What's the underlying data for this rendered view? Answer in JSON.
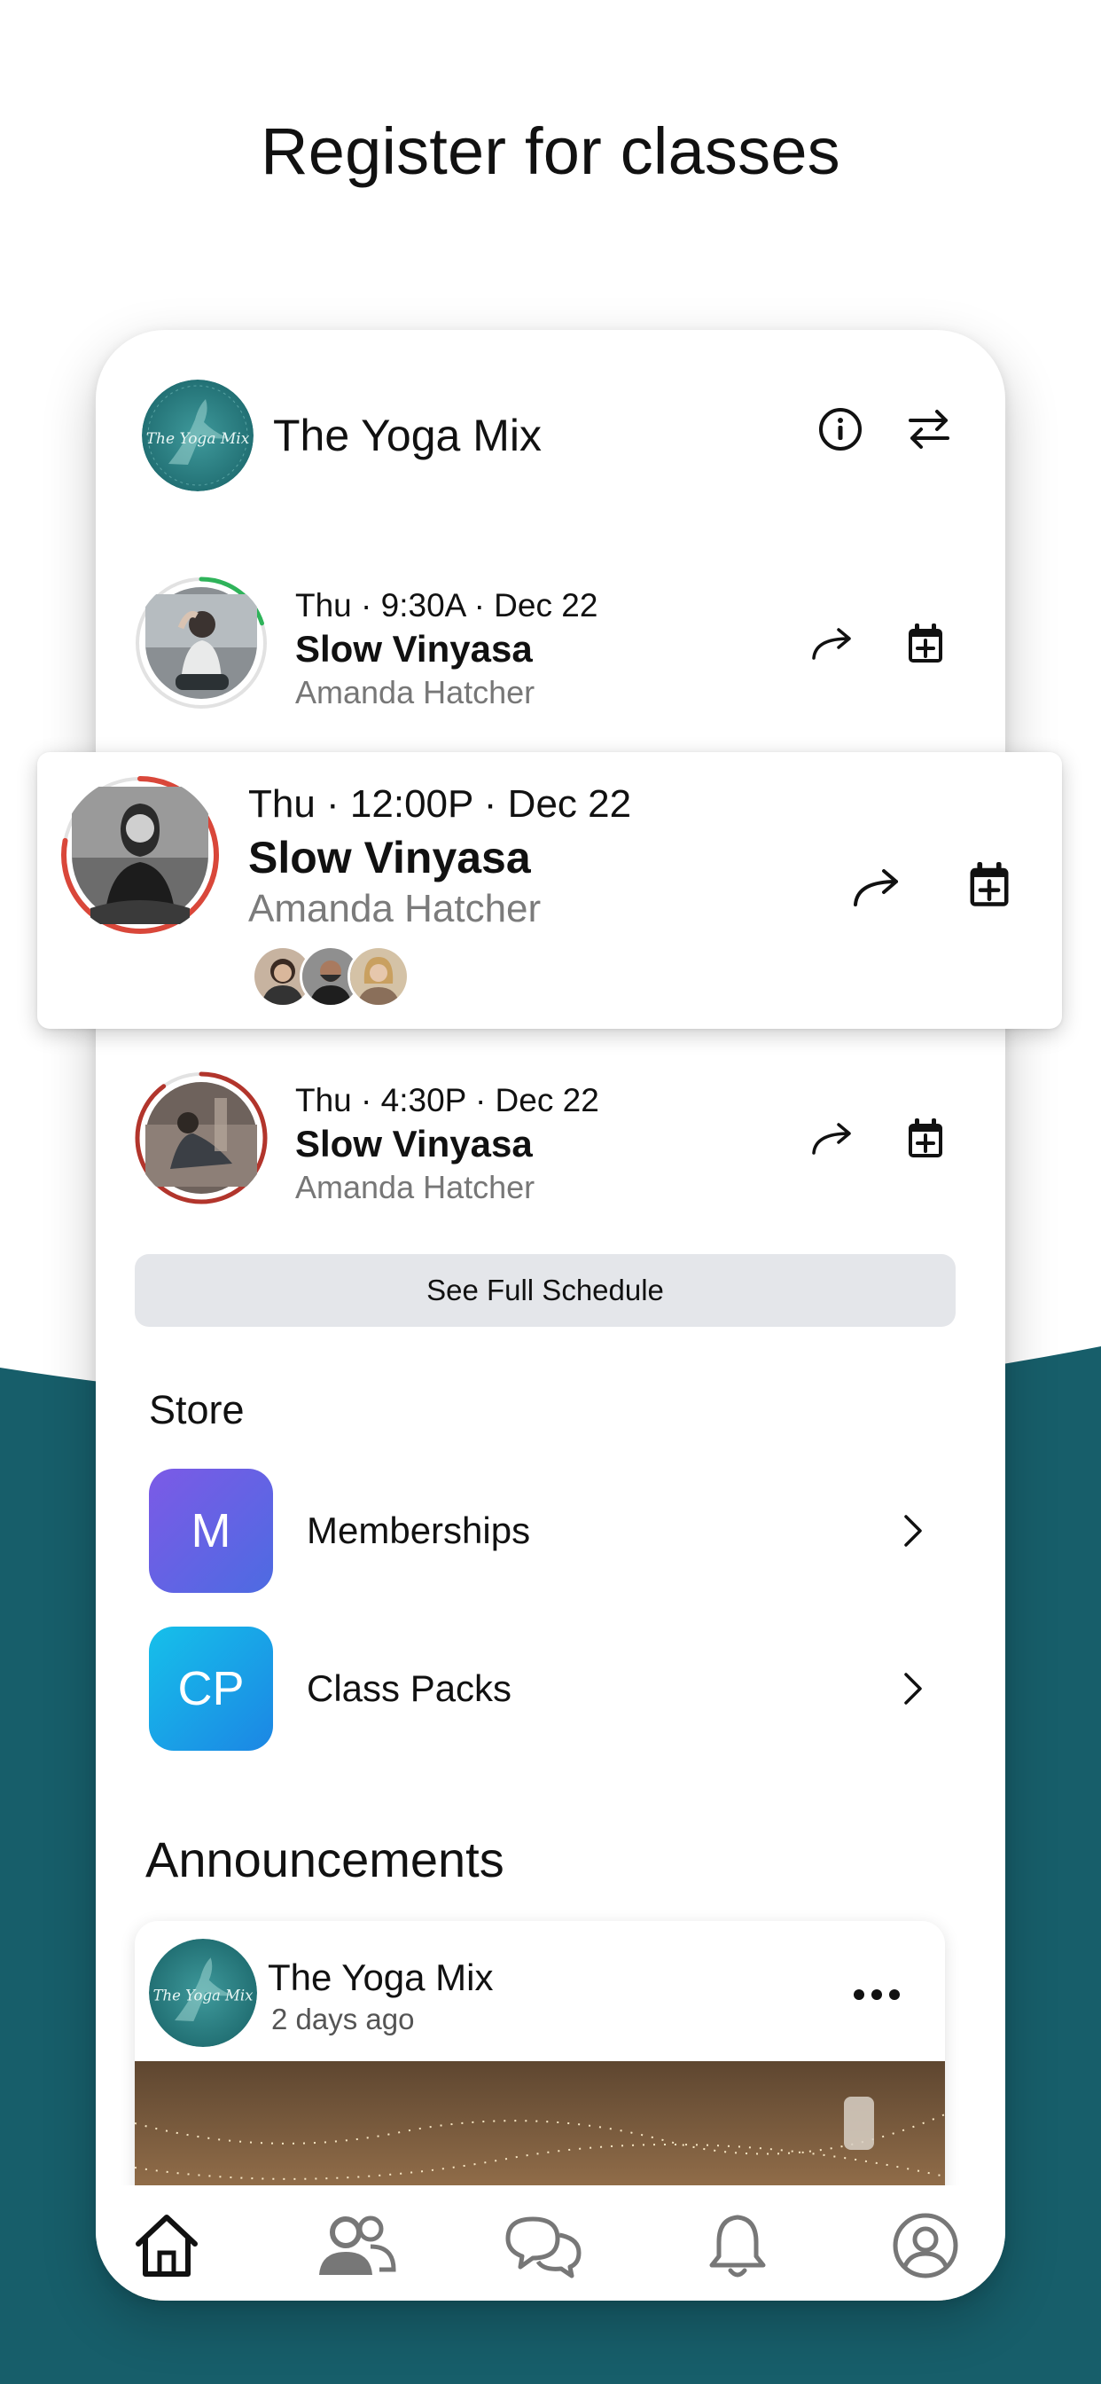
{
  "headline": "Register for classes",
  "colors": {
    "teal": "#175e6a",
    "accent_red": "#d9473a",
    "accent_green": "#2fb35a",
    "memberships_tile": "#6d5ce8",
    "class_packs_tile": "#1aa8e8"
  },
  "header": {
    "studio_name": "The Yoga Mix",
    "logo_text": "The Yoga Mix",
    "info_icon": "info-icon",
    "switch_icon": "swap-arrows-icon"
  },
  "classes": [
    {
      "meta": "Thu · 9:30A · Dec 22",
      "title": "Slow Vinyasa",
      "teacher": "Amanda Hatcher",
      "ring_color": "#2fb35a",
      "ring_fill": 0.2
    },
    {
      "meta": "Thu · 12:00P · Dec 22",
      "title": "Slow Vinyasa",
      "teacher": "Amanda Hatcher",
      "ring_color": "#d9473a",
      "ring_fill": 0.78,
      "attendee_count": 3
    },
    {
      "meta": "Thu · 4:30P · Dec 22",
      "title": "Slow Vinyasa",
      "teacher": "Amanda Hatcher",
      "ring_color": "#b2352c",
      "ring_fill": 0.9
    }
  ],
  "schedule_button": "See Full Schedule",
  "store": {
    "title": "Store",
    "items": [
      {
        "initials": "M",
        "label": "Memberships"
      },
      {
        "initials": "CP",
        "label": "Class Packs"
      }
    ]
  },
  "announcements": {
    "title": "Announcements",
    "post": {
      "author": "The Yoga Mix",
      "time": "2 days ago"
    }
  },
  "tabs": [
    "home-icon",
    "people-icon",
    "chat-icon",
    "bell-icon",
    "profile-icon"
  ]
}
